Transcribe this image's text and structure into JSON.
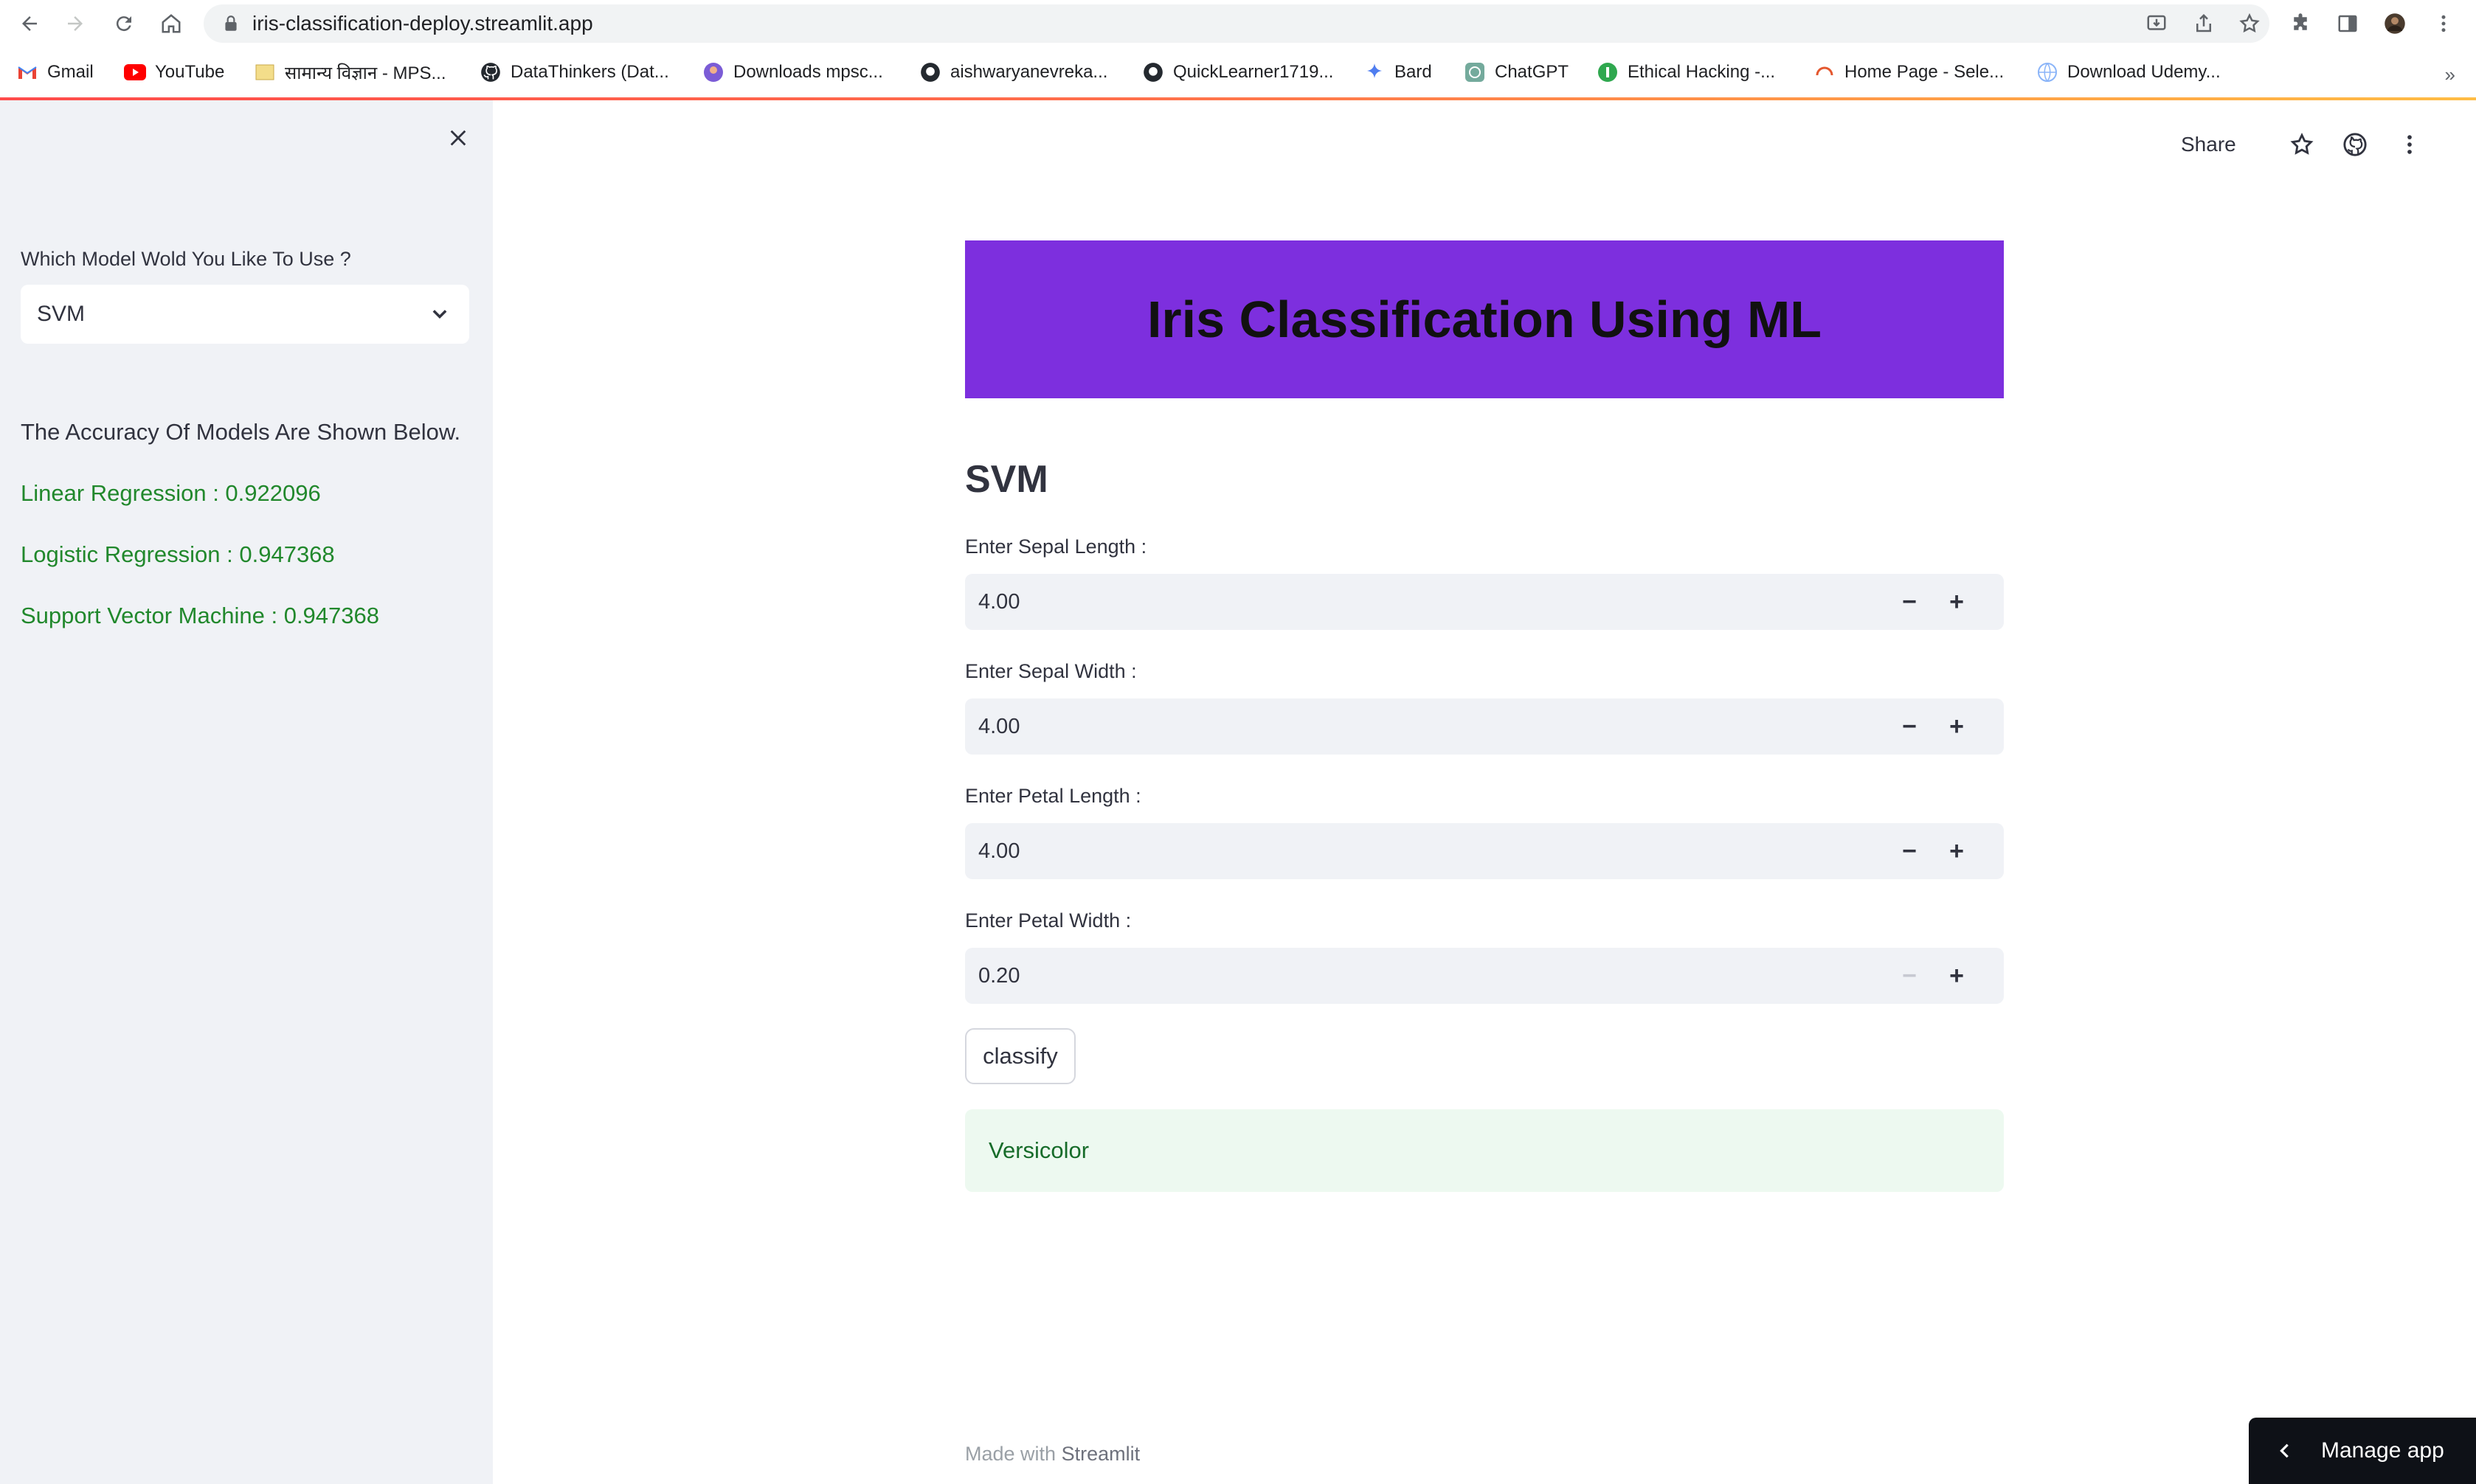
{
  "browser": {
    "url": "iris-classification-deploy.streamlit.app",
    "bookmarks": [
      {
        "label": "Gmail",
        "icon": "gmail-icon"
      },
      {
        "label": "YouTube",
        "icon": "youtube-icon"
      },
      {
        "label": "सामान्य विज्ञान - MPS...",
        "icon": "page-icon"
      },
      {
        "label": "DataThinkers (Dat...",
        "icon": "github-icon"
      },
      {
        "label": "Downloads mpsc...",
        "icon": "profile-icon"
      },
      {
        "label": "aishwaryanevreka...",
        "icon": "github-icon"
      },
      {
        "label": "QuickLearner1719...",
        "icon": "github-icon"
      },
      {
        "label": "Bard",
        "icon": "bard-icon"
      },
      {
        "label": "ChatGPT",
        "icon": "chatgpt-icon"
      },
      {
        "label": "Ethical Hacking -...",
        "icon": "hacking-icon"
      },
      {
        "label": "Home Page - Sele...",
        "icon": "selenium-icon"
      },
      {
        "label": "Download Udemy...",
        "icon": "globe-icon"
      }
    ],
    "more": "»"
  },
  "sidebar": {
    "select_label": "Which Model Wold You Like To Use ?",
    "select_value": "SVM",
    "accuracy_heading": "The Accuracy Of Models Are Shown Below.",
    "accuracies": [
      "Linear Regression : 0.922096",
      "Logistic Regression : 0.947368",
      "Support Vector Machine : 0.947368"
    ]
  },
  "header": {
    "share_label": "Share"
  },
  "main": {
    "title": "Iris Classification Using ML",
    "model_heading": "SVM",
    "inputs": [
      {
        "label": "Enter Sepal Length :",
        "value": "4.00"
      },
      {
        "label": "Enter Sepal Width :",
        "value": "4.00"
      },
      {
        "label": "Enter Petal Length :",
        "value": "4.00"
      },
      {
        "label": "Enter Petal Width :",
        "value": "0.20"
      }
    ],
    "stepper_minus": "−",
    "stepper_plus": "+",
    "classify_label": "classify",
    "result": "Versicolor"
  },
  "footer": {
    "made_with": "Made with",
    "brand": "Streamlit"
  },
  "manage_app": "Manage app",
  "colors": {
    "banner": "#7d2fde",
    "success_text": "#21882c",
    "success_bg": "#edf9f0",
    "sidebar_bg": "#f0f2f6"
  }
}
